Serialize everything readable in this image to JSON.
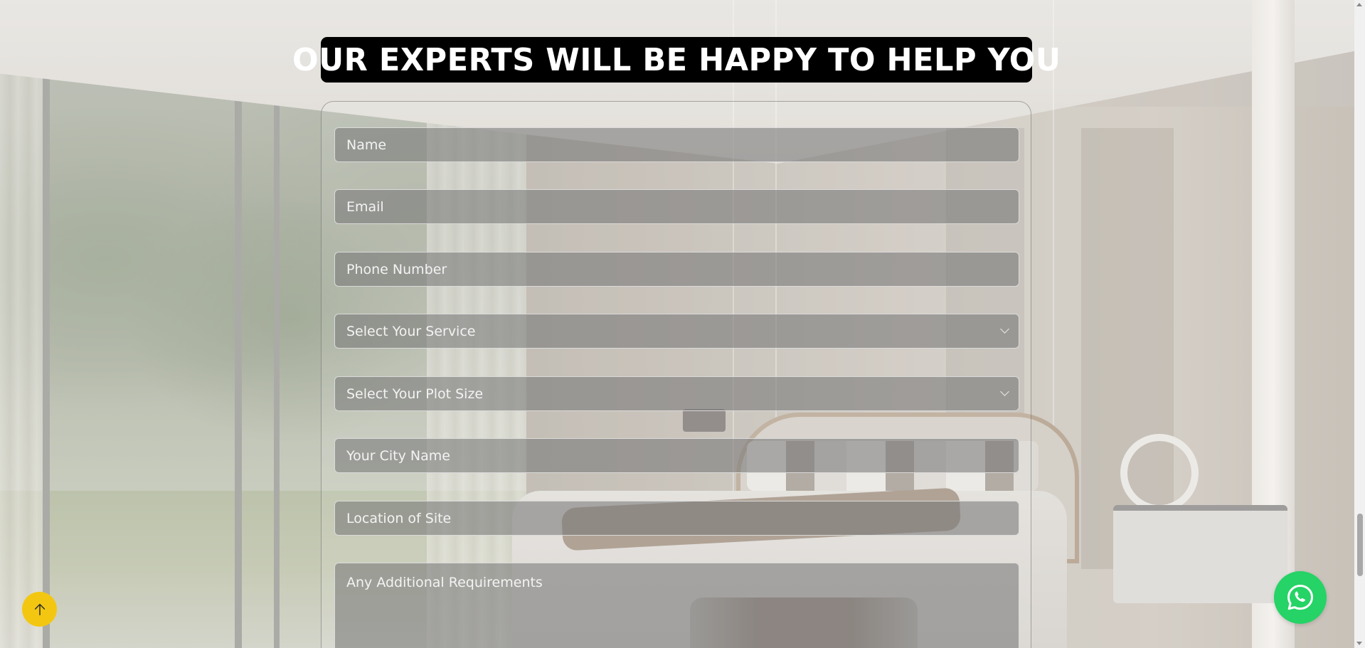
{
  "heading": {
    "title": "OUR EXPERTS WILL BE HAPPY TO HELP YOU"
  },
  "form": {
    "name": {
      "placeholder": "Name",
      "value": ""
    },
    "email": {
      "placeholder": "Email",
      "value": ""
    },
    "phone": {
      "placeholder": "Phone Number",
      "value": ""
    },
    "service": {
      "selected": "Select Your Service"
    },
    "plot_size": {
      "selected": "Select Your Plot Size"
    },
    "city": {
      "placeholder": "Your City Name",
      "value": ""
    },
    "location": {
      "placeholder": "Location of Site",
      "value": ""
    },
    "requirements": {
      "placeholder": "Any Additional Requirements",
      "value": ""
    }
  },
  "floating": {
    "back_to_top_icon": "arrow-up-icon",
    "back_to_top_color": "#f3c711",
    "whatsapp_icon": "whatsapp-icon",
    "whatsapp_color": "#25d366"
  },
  "colors": {
    "heading_background": "#000000",
    "heading_text": "#ffffff",
    "field_text": "#f3f3f3"
  }
}
